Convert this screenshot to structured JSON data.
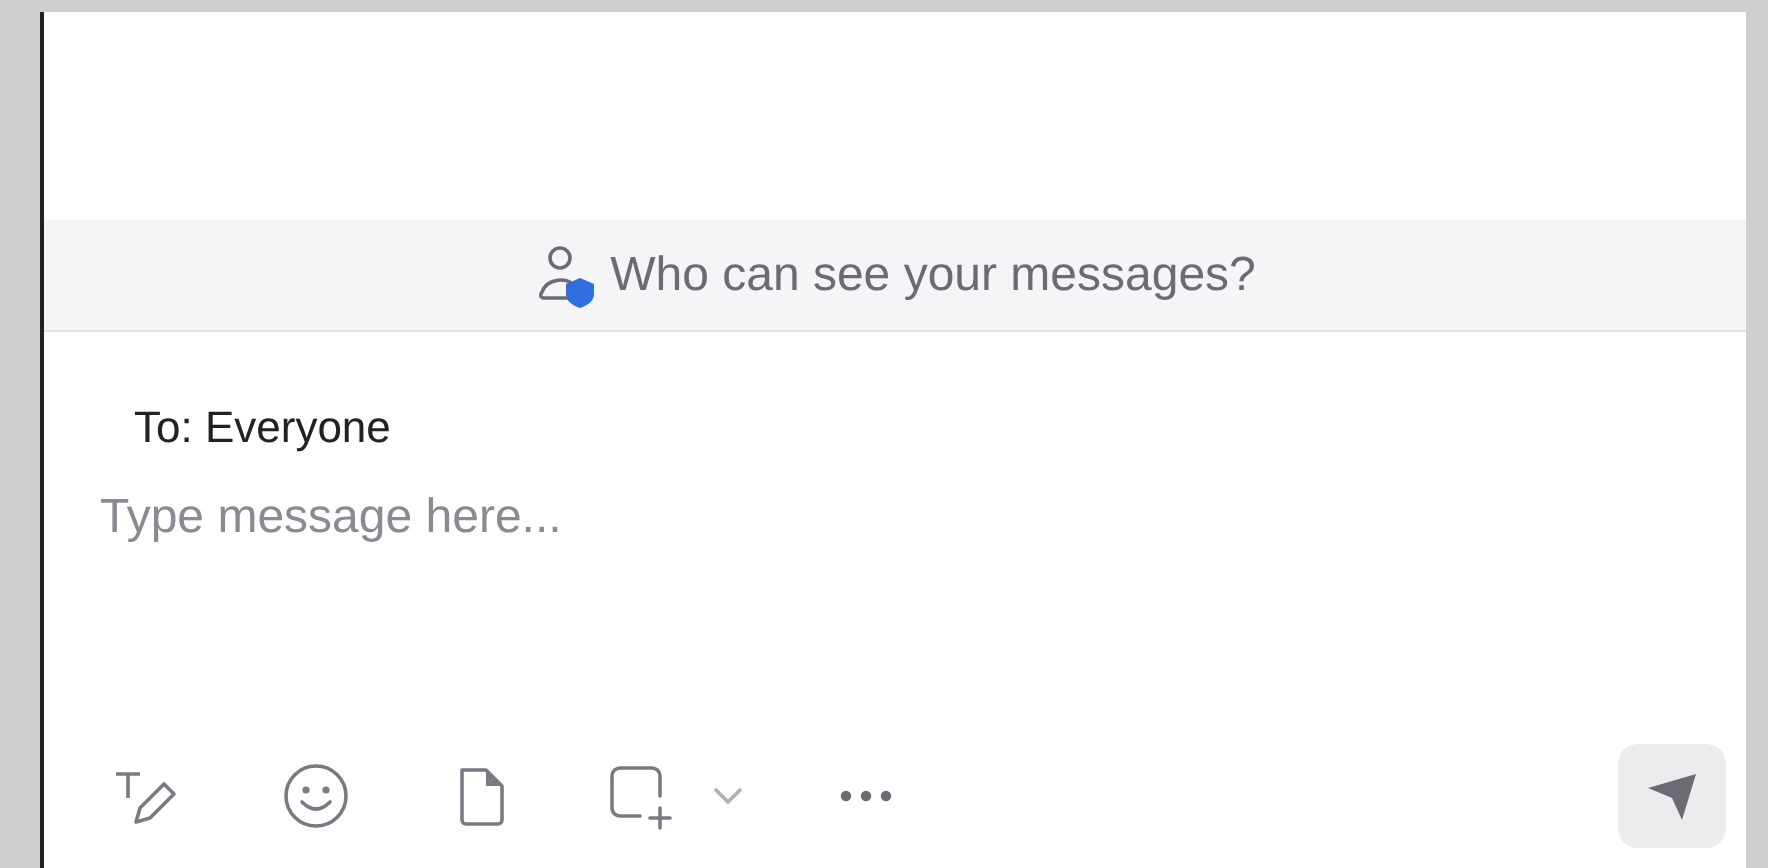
{
  "privacy_banner": {
    "text": "Who can see your messages?"
  },
  "recipient": {
    "label": "To: Everyone"
  },
  "message": {
    "placeholder": "Type message here..."
  },
  "toolbar": [
    {
      "kind": "format"
    },
    {
      "kind": "emoji"
    },
    {
      "kind": "file"
    },
    {
      "kind": "screenshot"
    },
    {
      "kind": "dropdown"
    },
    {
      "kind": "more"
    }
  ],
  "send_button": {
    "disabled": true
  }
}
